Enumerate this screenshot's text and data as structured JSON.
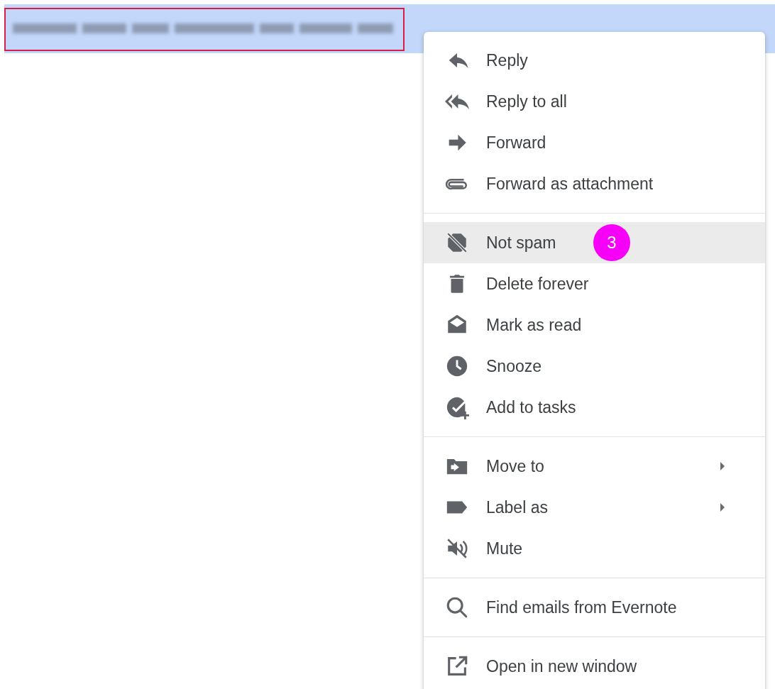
{
  "selected_message": {
    "kind": "blurred",
    "outlined": true
  },
  "context_menu": {
    "groups": [
      {
        "items": [
          {
            "label": "Reply",
            "selected": false,
            "has_submenu": false
          },
          {
            "label": "Reply to all",
            "selected": false,
            "has_submenu": false
          },
          {
            "label": "Forward",
            "selected": false,
            "has_submenu": false
          },
          {
            "label": "Forward as attachment",
            "selected": false,
            "has_submenu": false
          }
        ]
      },
      {
        "items": [
          {
            "label": "Not spam",
            "selected": true,
            "has_submenu": false,
            "badge": "3"
          },
          {
            "label": "Delete forever",
            "selected": false,
            "has_submenu": false
          },
          {
            "label": "Mark as read",
            "selected": false,
            "has_submenu": false
          },
          {
            "label": "Snooze",
            "selected": false,
            "has_submenu": false
          },
          {
            "label": "Add to tasks",
            "selected": false,
            "has_submenu": false
          }
        ]
      },
      {
        "items": [
          {
            "label": "Move to",
            "selected": false,
            "has_submenu": true
          },
          {
            "label": "Label as",
            "selected": false,
            "has_submenu": true
          },
          {
            "label": "Mute",
            "selected": false,
            "has_submenu": false
          }
        ]
      },
      {
        "items": [
          {
            "label": "Find emails from Evernote",
            "selected": false,
            "has_submenu": false
          }
        ]
      },
      {
        "items": [
          {
            "label": "Open in new window",
            "selected": false,
            "has_submenu": false
          }
        ]
      }
    ]
  }
}
